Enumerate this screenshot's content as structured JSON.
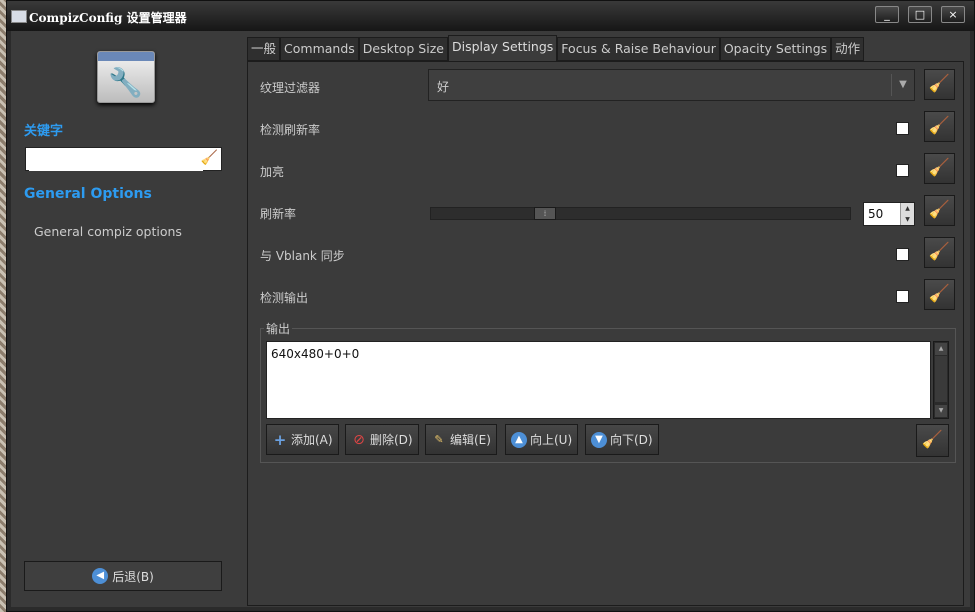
{
  "window": {
    "title": "CompizConfig 设置管理器",
    "controls": [
      "_",
      "□",
      "×"
    ]
  },
  "sidebar": {
    "keyword_label": "关键字",
    "search_value": "",
    "section_title": "General Options",
    "section_item": "General compiz options",
    "back_label": "后退(B)"
  },
  "tabs": [
    {
      "label": "一般"
    },
    {
      "label": "Commands"
    },
    {
      "label": "Desktop Size"
    },
    {
      "label": "Display Settings",
      "active": true
    },
    {
      "label": "Focus & Raise Behaviour"
    },
    {
      "label": "Opacity Settings"
    },
    {
      "label": "动作"
    }
  ],
  "settings": {
    "texture_filter": {
      "label": "纹理过滤器",
      "value": "好"
    },
    "detect_refresh": {
      "label": "检测刷新率",
      "checked": false
    },
    "lighting": {
      "label": "加亮",
      "checked": false
    },
    "refresh_rate": {
      "label": "刷新率",
      "value": "50",
      "slider_fraction": 0.26
    },
    "sync_vblank": {
      "label": "与 Vblank 同步",
      "checked": false
    },
    "detect_outputs": {
      "label": "检测输出",
      "checked": false
    }
  },
  "outputs": {
    "legend": "输出",
    "items": [
      "640x480+0+0"
    ],
    "buttons": {
      "add": "添加(A)",
      "delete": "删除(D)",
      "edit": "编辑(E)",
      "up": "向上(U)",
      "down": "向下(D)"
    }
  },
  "icons": {
    "reset": "broom-icon",
    "accent": "#2d9bf0",
    "broom_color": "#e5b21c"
  }
}
